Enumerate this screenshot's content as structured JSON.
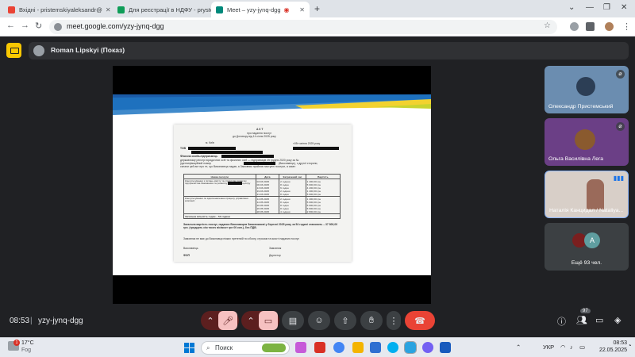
{
  "browser": {
    "tabs": [
      {
        "title": "Вхідні - pristemskiyaleksandr@",
        "active": false
      },
      {
        "title": "Для реєстрації в НДФУ - prystem",
        "active": false
      },
      {
        "title": "Meet – yzy-jynq-dgg",
        "active": true
      }
    ],
    "new_tab_label": "+",
    "url": "meet.google.com/yzy-jynq-dgg"
  },
  "presenter": {
    "name": "Roman Lipskyi (Показ)"
  },
  "document": {
    "title": "А К Т",
    "subtitle": "про надання послуг",
    "subtitle2": "до Договору від 14 січня 2025 року",
    "city": "м. Київ",
    "date": "«05» квітня 2025 року",
    "line1": "ТОВ",
    "line_fop": "Фізична особа-підприємець",
    "line_fop2": "державному реєстрі юридичних осіб та фізичних осіб — підприємців 25 грудня 2020 року за №",
    "line_fop3": "(ідентифікаційний номер",
    "line_fop4": "(Виконавець), з другої сторони,",
    "line_fop5": "склали цей акт про те, що Виконавець надав, а Замовник прийняв наступні послуги, а саме:",
    "table_headers": [
      "Назва послуги",
      "Дата",
      "Затрачений час",
      "Вартість"
    ],
    "service1": "Консультування з питань змісту та структури розвитку підприємства Замовника та розвитку",
    "service1_tail": "центру",
    "service2": "Консультування по вдосконаленню процесу управління компанії;",
    "dates1": [
      "03.03.2025",
      "06.03.2025",
      "13.03.2025",
      "19.03.2025",
      "21.03.2025"
    ],
    "hours1": [
      "2 години",
      "8 годин",
      "6 годин",
      "2 години",
      "8 годин"
    ],
    "costs1": [
      "1 400,00 грн",
      "5 600,00 грн",
      "4 200,00 грн",
      "1 400,00 грн",
      "5 600,00 грн"
    ],
    "dates2": [
      "14.05.2025",
      "14.05.2025",
      "20.05.2025",
      "26.05.2025",
      "28.05.2025"
    ],
    "hours2": [
      "2 години",
      "8 годин",
      "8 годин",
      "8 годин",
      "4 години"
    ],
    "costs2": [
      "1 400,00 грн",
      "5 600,00 грн",
      "5 600,00 грн",
      "5 600,00 грн",
      "2 800,00 грн"
    ],
    "total_hours": "Загальна кількість годин – 54 години",
    "summary": "Загальна вартість послуг, наданих Виконавцем Замовникові у березні 2025 року за 54 годині становить – 37 800,00 грн. (тридцять сім тисяч вісімсот грн 00 коп.), без ПДВ.",
    "claims": "Замовник не має до Виконавця ніяких претензій по обсягу, строкам та якості наданих послуг.",
    "executor": "Виконавець",
    "customer": "Замовник",
    "executor_role": "ФОП",
    "customer_role": "Директор"
  },
  "participants": [
    {
      "name": "Олександр Пристемський",
      "muted": true
    },
    {
      "name": "Ольга Василівна Лега",
      "muted": true
    },
    {
      "name": "Наталія Канцидал / Nataliya...",
      "muted": false
    },
    {
      "name": "Ещё 93 чел.",
      "initial": "A"
    }
  ],
  "bottom_bar": {
    "time": "08:53",
    "separator": "|",
    "meeting_code": "yzy-jynq-dgg",
    "participants_count": "97"
  },
  "taskbar": {
    "weather_temp": "17°C",
    "weather_desc": "Fog",
    "weather_badge": "1",
    "search_placeholder": "Поиск",
    "language": "УКР",
    "clock_time": "08:53",
    "clock_date": "22.05.2025"
  }
}
